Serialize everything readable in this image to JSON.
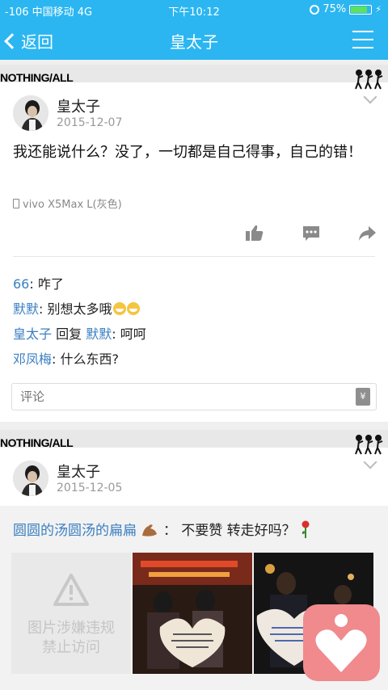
{
  "status": {
    "carrier": "-106 中国移动  4G",
    "time": "下午10:12",
    "battery": "75%",
    "battery_level": 0.75
  },
  "nav": {
    "back_label": "返回",
    "title": "皇太子"
  },
  "posts": [
    {
      "banner": "NOTHING/ALL",
      "user": "皇太子",
      "date": "2015-12-07",
      "text": "我还能说什么？没了，一切都是自己得事，自己的错！",
      "device": "vivo X5Max L(灰色)",
      "comments": [
        {
          "user": "66",
          "sep": ": ",
          "text": "咋了"
        },
        {
          "user": "默默",
          "sep": ": ",
          "text": "别想太多哦"
        },
        {
          "user": "皇太子",
          "reply_word": " 回复 ",
          "reply_to": "默默",
          "sep": ": ",
          "text": "呵呵"
        },
        {
          "user": "邓凤梅",
          "sep": ": ",
          "text": "什么东西?"
        }
      ],
      "comment_placeholder": "评论",
      "send_icon_text": "¥"
    },
    {
      "banner": "NOTHING/ALL",
      "user": "皇太子",
      "date": "2015-12-05",
      "share_user": "圆圆的汤圆汤的扁扁",
      "share_text": "：  不要赞    转走好吗？",
      "blocked_line1": "图片涉嫌违规",
      "blocked_line2": "禁止访问"
    }
  ],
  "colors": {
    "accent": "#2bb6f1",
    "link": "#3a7fc1",
    "fab": "#f08a8d"
  }
}
